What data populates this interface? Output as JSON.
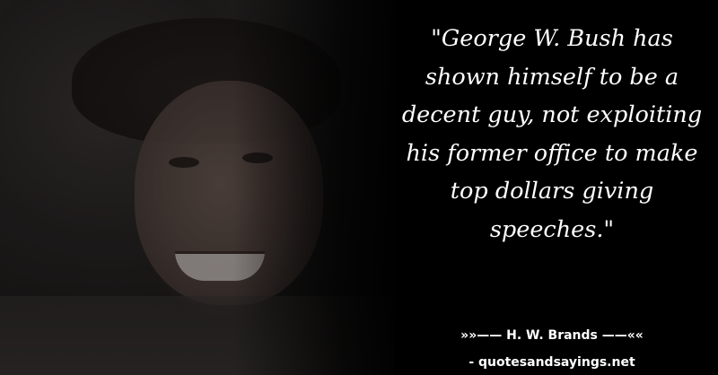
{
  "quote": {
    "text": "\"George W. Bush has shown himself to be a decent guy, not exploiting his former office to make top dollars giving speeches.\""
  },
  "attribution": {
    "author_line": "»»—— H. W. Brands ——««",
    "source_line": "- quotesandsayings.net"
  },
  "colors": {
    "background": "#000000",
    "text": "#ffffff"
  }
}
